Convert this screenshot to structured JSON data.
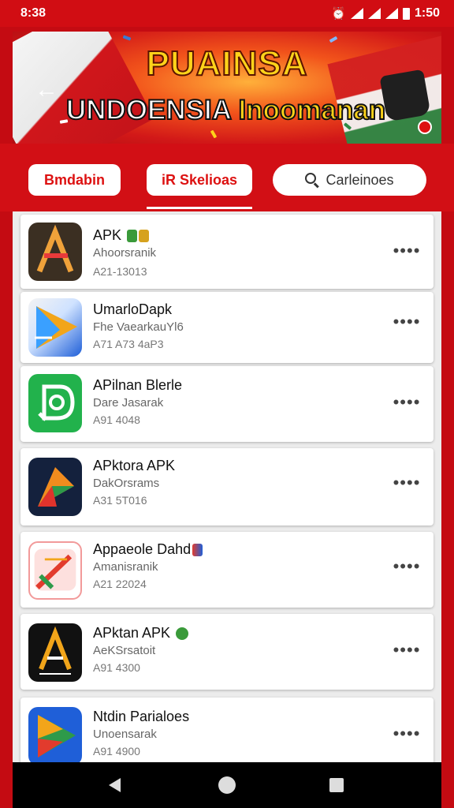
{
  "status_bar": {
    "time": "8:38",
    "clock": "1:50"
  },
  "banner": {
    "title": "PUAINSA",
    "subtitle_main": "UNDOENSIA",
    "subtitle_accent": "Inoomanan"
  },
  "tabs": [
    {
      "label": "Bmdabin"
    },
    {
      "label": "iR Skelioas"
    },
    {
      "label": "Carleinoes"
    }
  ],
  "apps": [
    {
      "name": "APK",
      "developer": "Ahoorsranik",
      "version": "A21-13013",
      "icon": "a-letter-icon",
      "tags": [
        "green-badge",
        "yellow-badge"
      ]
    },
    {
      "name": "UmarloDapk",
      "developer": "Fhe VaearkauYl6",
      "version": "A71 A73 4aP3",
      "icon": "arrow-play-icon",
      "tags": []
    },
    {
      "name": "APilnan Blerle",
      "developer": "Dare Jasarak",
      "version": "A91 4048",
      "icon": "chat-bubble-icon",
      "tags": []
    },
    {
      "name": "APktora APK",
      "developer": "DakOrsrams",
      "version": "A31 5T016",
      "icon": "p-letter-icon",
      "tags": []
    },
    {
      "name": "Appaeole Dahd",
      "developer": "Amanisranik",
      "version": "A21 22024",
      "icon": "play-store-icon",
      "tags": [
        "multi-badge"
      ]
    },
    {
      "name": "APktan APK",
      "developer": "AeKSrsatoit",
      "version": "A91 4300",
      "icon": "a-triangle-icon",
      "tags": [
        "green-badge"
      ]
    },
    {
      "name": "Ntdin Parialoes",
      "developer": "Unoensarak",
      "version": "A91 4900",
      "icon": "play-triangle-icon",
      "tags": []
    }
  ],
  "more_label": "••••",
  "colors": {
    "primary": "#d10d13",
    "banner_text": "#ffd31a"
  }
}
